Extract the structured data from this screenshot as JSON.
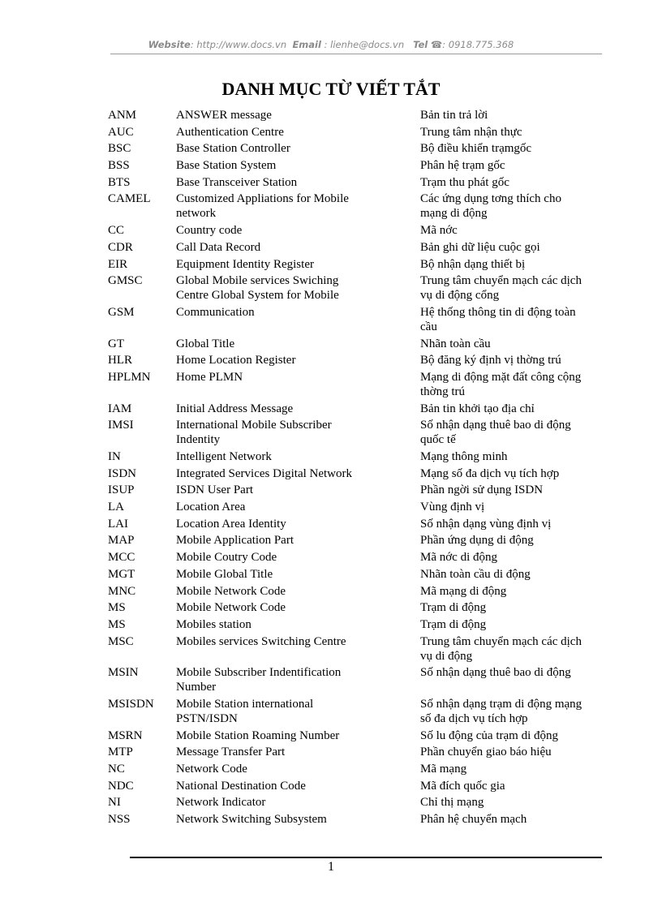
{
  "header": {
    "website_label": "Website",
    "website_value": ": http://www.docs.vn",
    "email_label": "Email",
    "email_value": ": lienhe@docs.vn",
    "tel_label": "Tel",
    "tel_icon": "phone-icon",
    "tel_value": ": 0918.775.368"
  },
  "title": "DANH MỤC TỪ VIẾT TẮT",
  "rows": [
    {
      "abbr": "ANM",
      "en": "ANSWER message",
      "vi": "Bản tin trả lời"
    },
    {
      "abbr": "AUC",
      "en": "Authentication Centre",
      "vi": "Trung tâm nhận thực"
    },
    {
      "abbr": "BSC",
      "en": "Base Station Controller",
      "vi": "Bộ điều khiển trạmgốc"
    },
    {
      "abbr": "BSS",
      "en": "Base Station System",
      "vi": "Phân hệ trạm gốc"
    },
    {
      "abbr": "BTS",
      "en": "Base Transceiver Station",
      "vi": "Trạm thu phát gốc"
    },
    {
      "abbr": "CAMEL",
      "en": "Customized Appliations for Mobile\nnetwork",
      "vi": "Các ứng dụng tơng    thích cho\nmạng di động"
    },
    {
      "abbr": "CC",
      "en": "Country code",
      "vi": "Mã nớc"
    },
    {
      "abbr": "CDR",
      "en": "Call Data Record",
      "vi": "Bản ghi dữ liệu cuộc gọi"
    },
    {
      "abbr": "EIR",
      "en": "Equipment Identity Register",
      "vi": "Bộ nhận dạng thiết bị"
    },
    {
      "abbr": "GMSC",
      "en": "Global Mobile services Swiching\nCentre Global System for Mobile",
      "vi": "Trung tâm chuyển mạch các dịch\nvụ di động cổng"
    },
    {
      "abbr": "GSM",
      "en": "Communication",
      "vi": "Hệ thống thông tin di động toàn\ncầu"
    },
    {
      "abbr": "GT",
      "en": "Global Title",
      "vi": "Nhãn toàn cầu"
    },
    {
      "abbr": "HLR",
      "en": "Home Location Register",
      "vi": "Bộ đăng ký định vị thờng    trú"
    },
    {
      "abbr": "HPLMN",
      "en": "Home PLMN",
      "vi": "Mạng di động mặt đất công cộng\nthờng    trú"
    },
    {
      "abbr": "IAM",
      "en": "Initial Address Message",
      "vi": "Bản tin khởi tạo địa chỉ"
    },
    {
      "abbr": "IMSI",
      "en": "International Mobile Subscriber\nIndentity",
      "vi": "Số nhận dạng thuê bao di động\nquốc tế"
    },
    {
      "abbr": "IN",
      "en": "Intelligent Network",
      "vi": "Mạng thông minh"
    },
    {
      "abbr": "ISDN",
      "en": "Integrated Services Digital Network",
      "vi": "Mạng số đa dịch vụ tích hợp"
    },
    {
      "abbr": "ISUP",
      "en": "ISDN User Part",
      "vi": "Phần ngời    sử dụng ISDN"
    },
    {
      "abbr": "LA",
      "en": "Location Area",
      "vi": "Vùng định vị"
    },
    {
      "abbr": "LAI",
      "en": "Location Area Identity",
      "vi": "Số nhận dạng vùng định vị"
    },
    {
      "abbr": "MAP",
      "en": "Mobile Application Part",
      "vi": "Phần ứng dụng di động"
    },
    {
      "abbr": "MCC",
      "en": "Mobile Coutry Code",
      "vi": "Mã nớc    di động"
    },
    {
      "abbr": "MGT",
      "en": "Mobile Global Title",
      "vi": "Nhãn toàn cầu di động"
    },
    {
      "abbr": "MNC",
      "en": "Mobile Network Code",
      "vi": "Mã mạng di động"
    },
    {
      "abbr": "MS",
      "en": "Mobile Network Code",
      "vi": "Trạm di động"
    },
    {
      "abbr": "MS",
      "en": "Mobiles station",
      "vi": "Trạm di động"
    },
    {
      "abbr": "MSC",
      "en": "Mobiles services Switching Centre",
      "vi": "Trung tâm chuyển mạch các dịch\nvụ di động"
    },
    {
      "abbr": "MSIN",
      "en": "Mobile Subscriber Indentification\nNumber",
      "vi": "Số nhận dạng thuê bao di động"
    },
    {
      "abbr": "MSISDN",
      "en": "Mobile Station international\nPSTN/ISDN",
      "vi": "Số nhận dạng trạm di động mạng\nsố đa dịch vụ tích hợp"
    },
    {
      "abbr": "MSRN",
      "en": "Mobile Station Roaming Number",
      "vi": "Số lu    động của trạm di động"
    },
    {
      "abbr": "MTP",
      "en": "Message Transfer Part",
      "vi": "Phần chuyển giao báo hiệu"
    },
    {
      "abbr": "NC",
      "en": "Network Code",
      "vi": "Mã mạng"
    },
    {
      "abbr": "NDC",
      "en": "National Destination Code",
      "vi": "Mã đích quốc gia"
    },
    {
      "abbr": "NI",
      "en": "Network Indicator",
      "vi": "Chỉ thị mạng"
    },
    {
      "abbr": "NSS",
      "en": "Network Switching Subsystem",
      "vi": "Phân hệ chuyển mạch"
    }
  ],
  "page_number": "1"
}
